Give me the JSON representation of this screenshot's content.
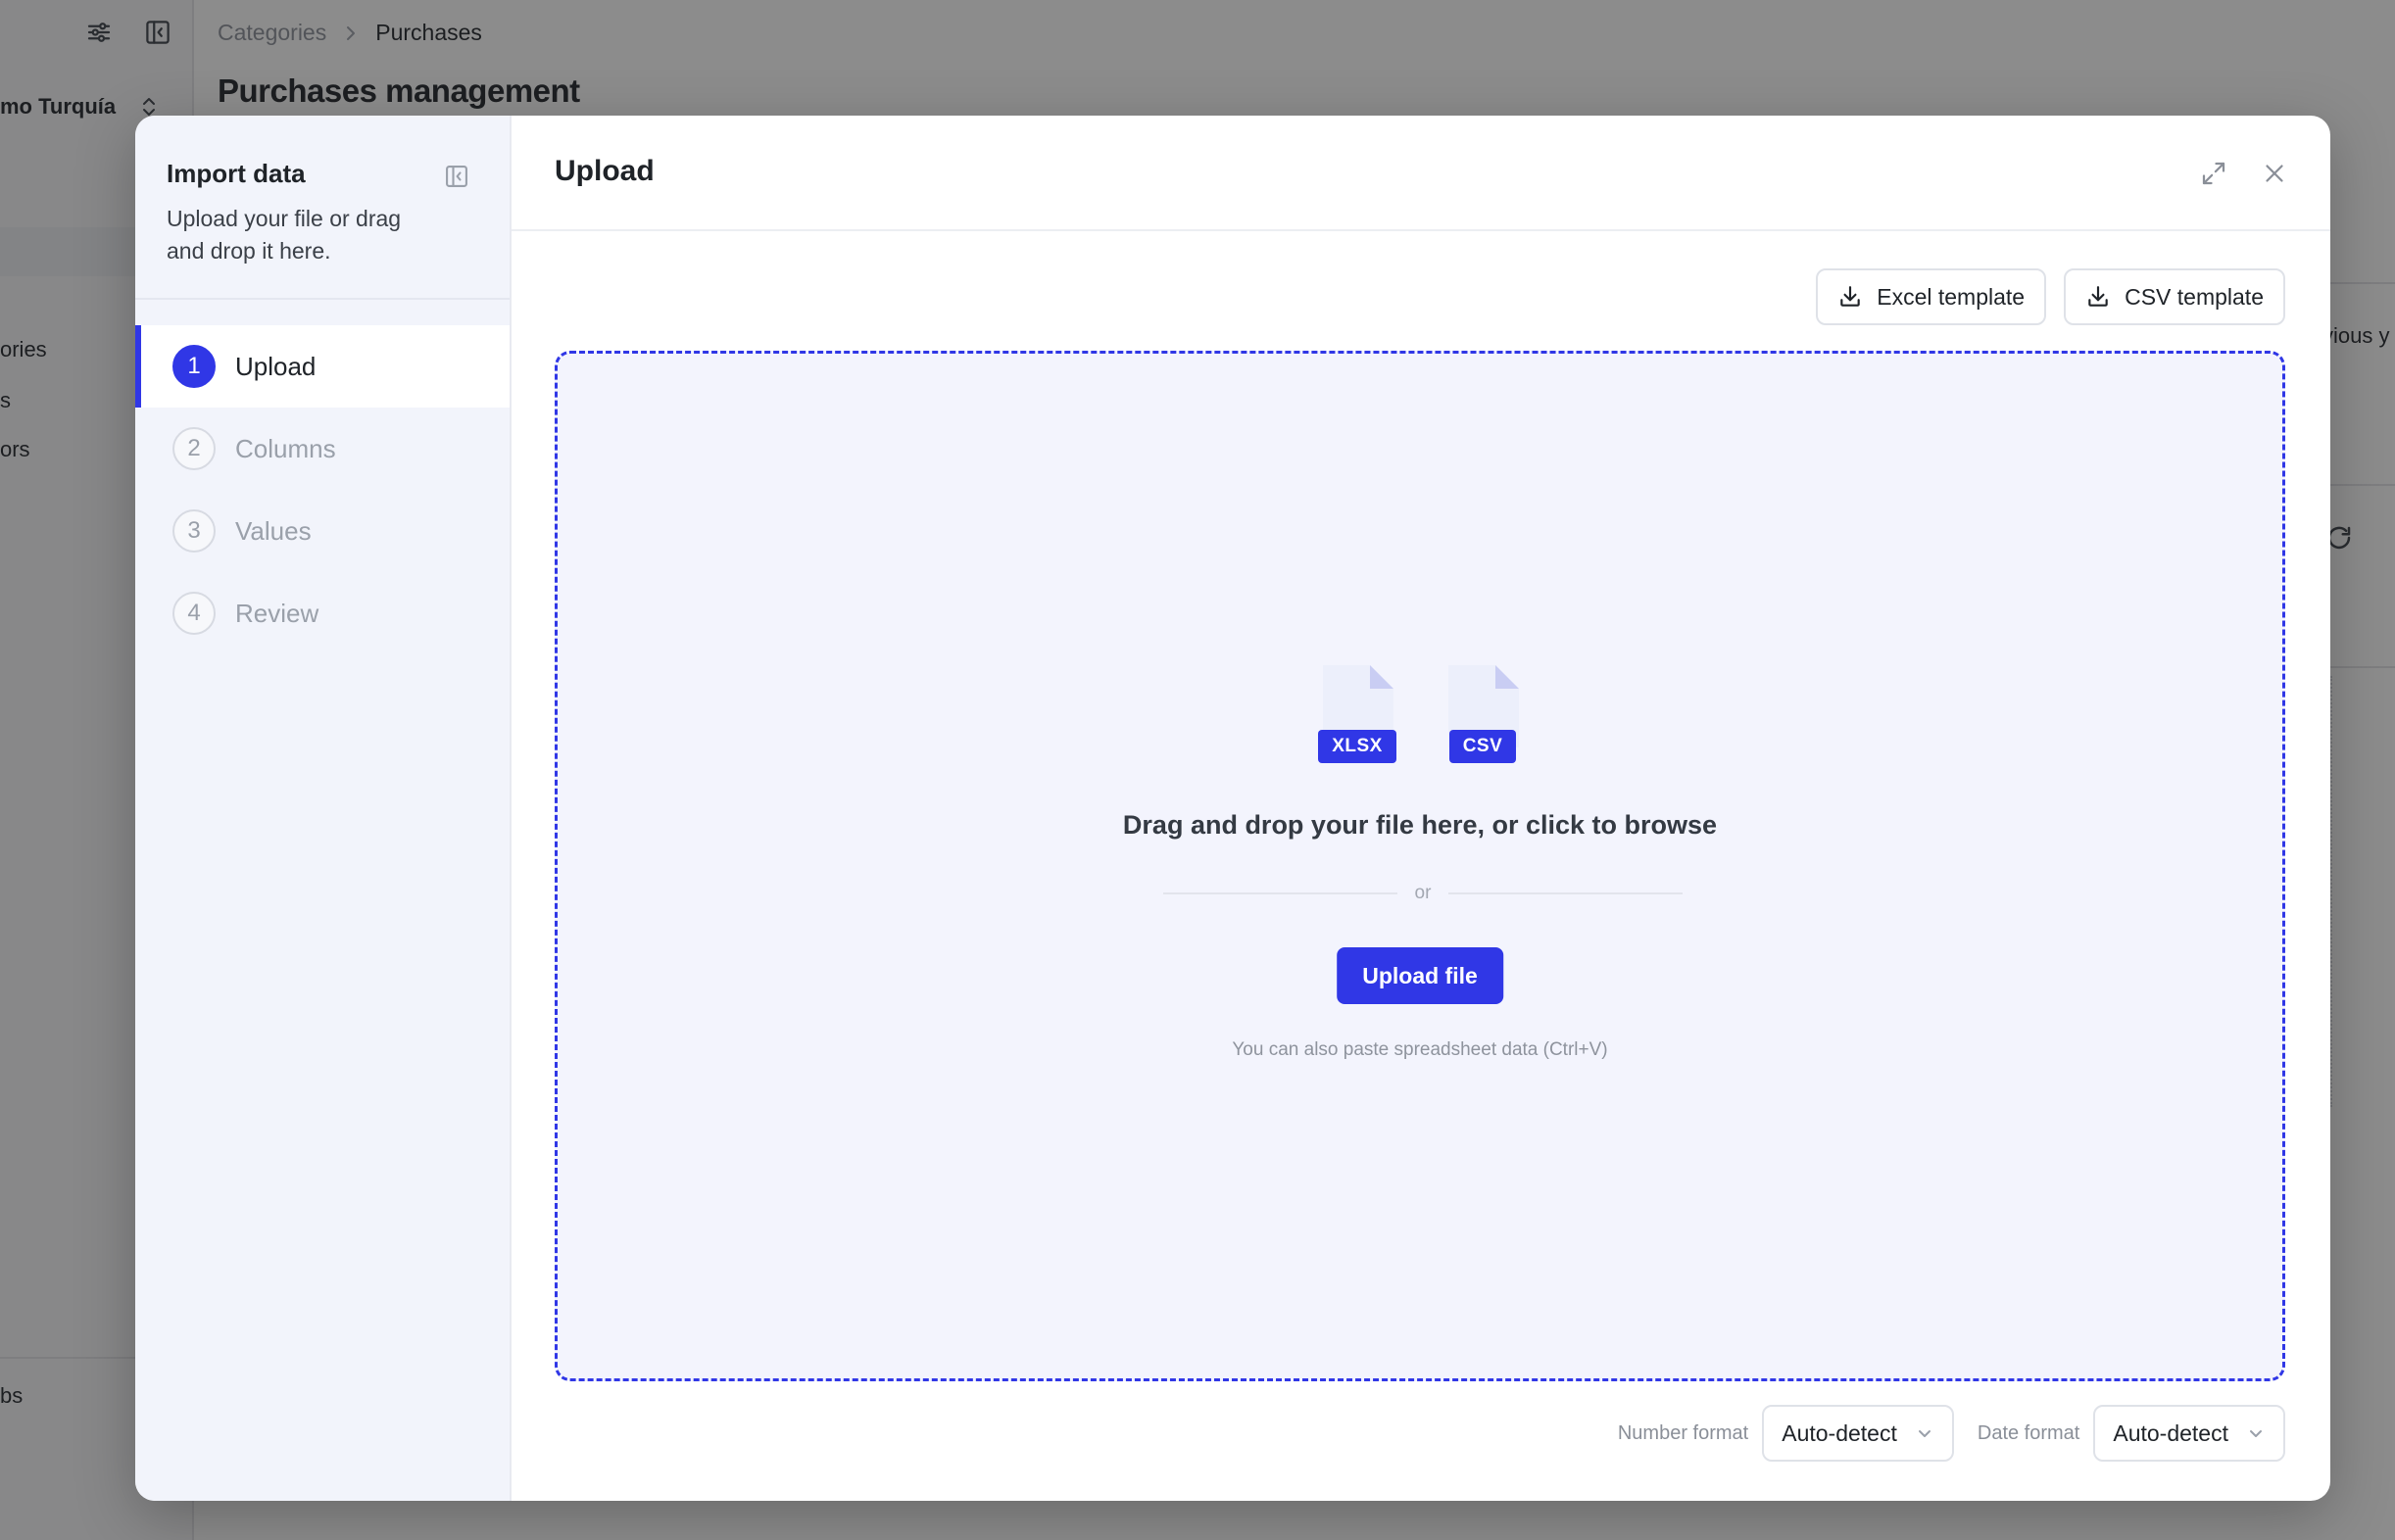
{
  "background": {
    "workspace": "mo Turquía",
    "nav_items": [
      "ories",
      "s",
      "ors"
    ],
    "footer_item": "bs",
    "breadcrumb": {
      "parent": "Categories",
      "current": "Purchases"
    },
    "page_title": "Purchases management",
    "right_partial_text": "vious y"
  },
  "modal": {
    "sidebar": {
      "title": "Import data",
      "subtitle": "Upload your file or drag and drop it here.",
      "steps": [
        {
          "number": "1",
          "label": "Upload",
          "active": true
        },
        {
          "number": "2",
          "label": "Columns",
          "active": false
        },
        {
          "number": "3",
          "label": "Values",
          "active": false
        },
        {
          "number": "4",
          "label": "Review",
          "active": false
        }
      ]
    },
    "header": {
      "title": "Upload"
    },
    "templates": {
      "excel_label": "Excel template",
      "csv_label": "CSV template"
    },
    "dropzone": {
      "file_types": [
        "XLSX",
        "CSV"
      ],
      "title": "Drag and drop your file here, or click to browse",
      "divider": "or",
      "button_label": "Upload file",
      "hint": "You can also paste spreadsheet data (Ctrl+V)"
    },
    "formats": {
      "number_label": "Number format",
      "number_value": "Auto-detect",
      "date_label": "Date format",
      "date_value": "Auto-detect"
    }
  },
  "colors": {
    "accent": "#3037e6",
    "dropzone_bg": "#f3f4fd",
    "sidebar_bg": "#f2f4fb"
  },
  "icons": [
    "sliders-icon",
    "sidebar-collapse-icon",
    "chevron-up-down-icon",
    "chevron-right-icon",
    "expand-icon",
    "close-icon",
    "download-icon",
    "file-icon",
    "chevron-down-icon",
    "refresh-icon"
  ]
}
